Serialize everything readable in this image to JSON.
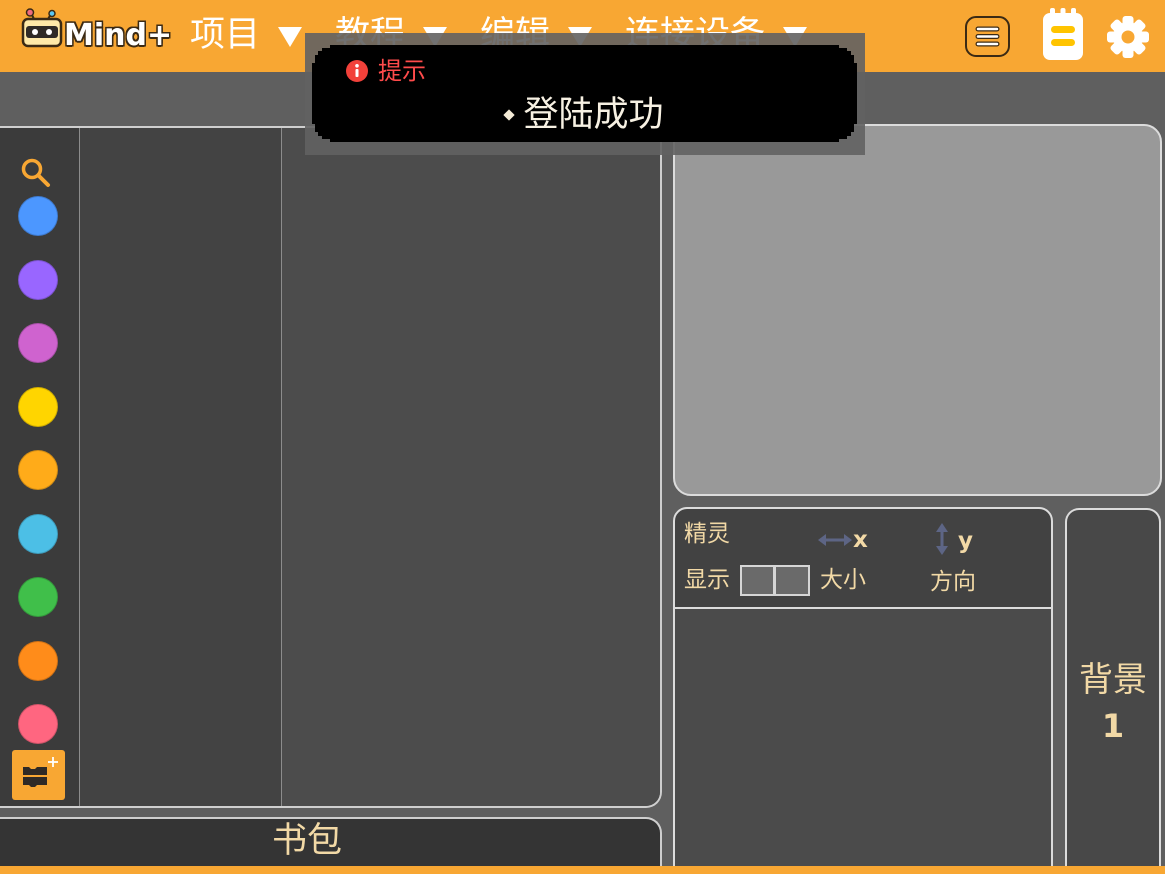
{
  "app": {
    "logo_text": "Mind+",
    "logo_icon": "robot-logo-icon"
  },
  "menu": [
    {
      "label": "项目",
      "icon": "dropdown-arrow-icon"
    },
    {
      "label": "教程",
      "icon": "dropdown-arrow-icon"
    },
    {
      "label": "编辑",
      "icon": "dropdown-arrow-icon"
    },
    {
      "label": "连接设备",
      "icon": "dropdown-arrow-icon"
    }
  ],
  "toolbar_icons": {
    "menu": "hamburger-menu-icon",
    "notebook": "notebook-icon",
    "settings": "gear-icon"
  },
  "toast": {
    "icon": "info-icon",
    "title": "提示",
    "bullet_icon": "diamond-bullet-icon",
    "message": "登陆成功"
  },
  "block_categories": {
    "search_icon": "search-icon",
    "items": [
      {
        "color": "#4C97FF"
      },
      {
        "color": "#9966FF"
      },
      {
        "color": "#CF63CF"
      },
      {
        "color": "#FFD500"
      },
      {
        "color": "#FFAB19"
      },
      {
        "color": "#4CBFE6"
      },
      {
        "color": "#40BF4A"
      },
      {
        "color": "#FF8C1A"
      },
      {
        "color": "#FF6680"
      }
    ],
    "extension_icon": "add-extension-icon"
  },
  "backpack": {
    "label": "书包"
  },
  "sprite_info": {
    "sprite_label": "精灵",
    "x_icon": "horizontal-arrow-icon",
    "x_label": "x",
    "y_icon": "vertical-arrow-icon",
    "y_label": "y",
    "show_label": "显示",
    "size_label": "大小",
    "direction_label": "方向"
  },
  "stage_target": {
    "label": "背景",
    "count": "1"
  },
  "colors": {
    "brand_orange": "#F8A733",
    "panel_text": "#F2D9A6",
    "toast_title": "#FF4B4B",
    "stage_fill": "#999999"
  }
}
